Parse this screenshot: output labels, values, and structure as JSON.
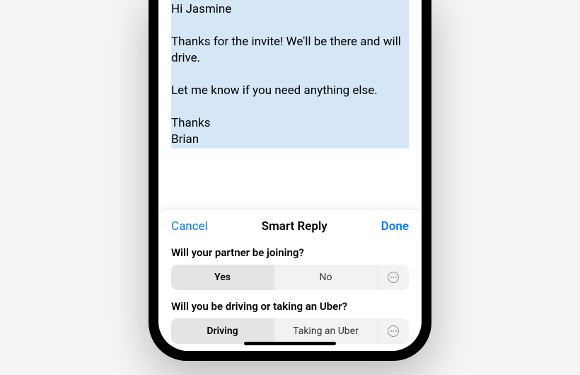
{
  "email": {
    "greeting": "Hi Jasmine",
    "body1": "Thanks for the invite! We'll be there and will drive.",
    "body2": "Let me know if you need anything else.",
    "signoff": "Thanks",
    "sender": "Brian"
  },
  "sheet": {
    "cancel_label": "Cancel",
    "title": "Smart Reply",
    "done_label": "Done",
    "questions": [
      {
        "prompt": "Will your partner be joining?",
        "option_a": "Yes",
        "option_b": "No"
      },
      {
        "prompt": "Will you be driving or taking an Uber?",
        "option_a": "Driving",
        "option_b": "Taking an Uber"
      }
    ]
  }
}
